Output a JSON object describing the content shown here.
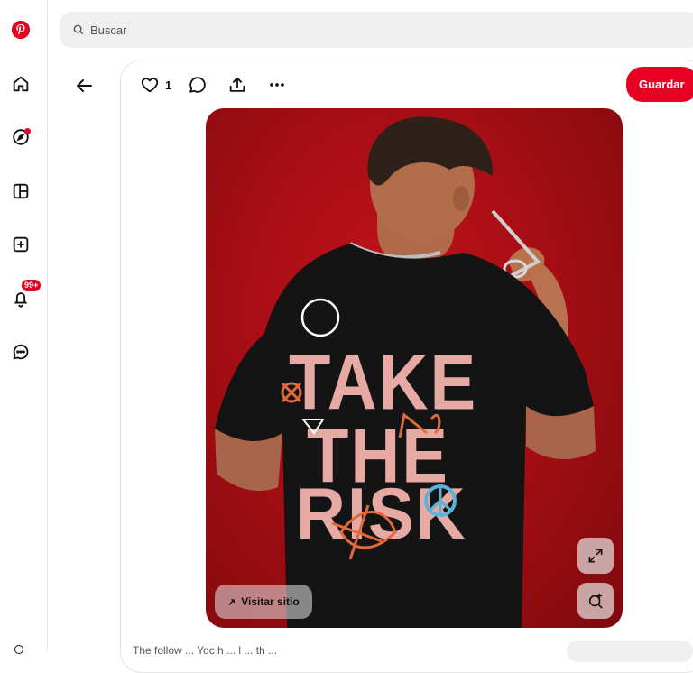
{
  "sidebar": {
    "items": [
      {
        "name": "pinterest-logo",
        "icon": "pinterest-logo-icon"
      },
      {
        "name": "home",
        "icon": "home-icon"
      },
      {
        "name": "explore",
        "icon": "compass-icon"
      },
      {
        "name": "boards",
        "icon": "boards-icon"
      },
      {
        "name": "create",
        "icon": "plus-square-icon"
      },
      {
        "name": "notifications",
        "icon": "bell-icon",
        "badge": "99+"
      },
      {
        "name": "messages",
        "icon": "chat-icon"
      }
    ]
  },
  "search": {
    "placeholder": "Buscar"
  },
  "pin": {
    "like_count": "1",
    "save_label": "Guardar",
    "visit_label": "Visitar sitio",
    "visit_arrow": "↗",
    "description_fragment": "The follow ... Yoc h ... l ... th ..."
  },
  "colors": {
    "brand": "#e60023",
    "background": "#ffffff",
    "search_bg": "#efefef"
  }
}
